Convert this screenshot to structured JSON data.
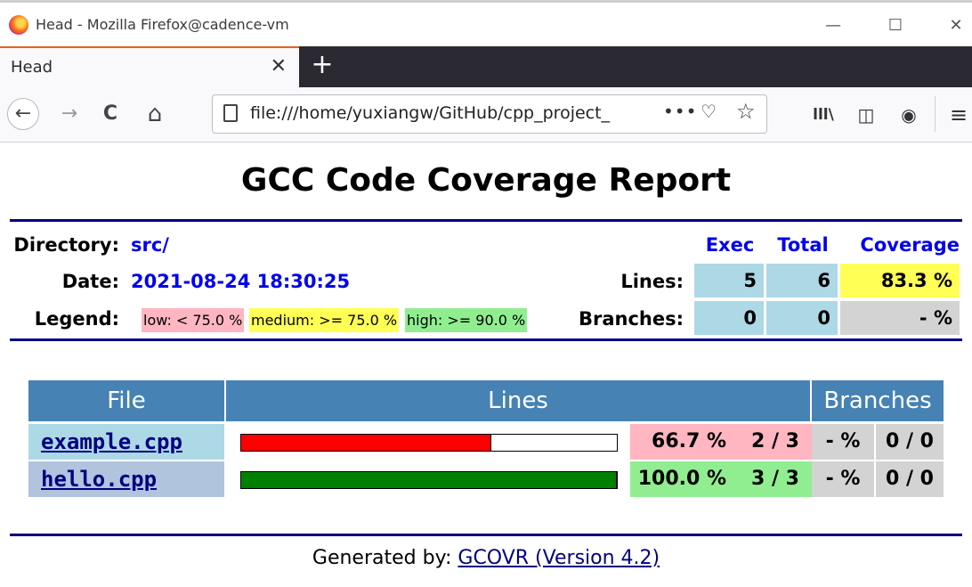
{
  "window": {
    "title": "Head - Mozilla Firefox@cadence-vm",
    "minimize_glyph": "—",
    "maximize_glyph": "☐",
    "close_glyph": "✕"
  },
  "tabs": [
    {
      "label": "Head",
      "close_glyph": "✕"
    }
  ],
  "new_tab_glyph": "+",
  "nav": {
    "back_glyph": "←",
    "forward_glyph": "→",
    "reload_glyph": "C",
    "home_glyph": "⌂",
    "url": "file:///home/yuxiangw/GitHub/cpp_project_",
    "more_glyph": "•••",
    "pocket_glyph": "♡",
    "bookmark_glyph": "☆",
    "library_glyph": "lll\\",
    "sidebar_glyph": "◫",
    "account_glyph": "◉",
    "menu_glyph": "≡"
  },
  "report": {
    "title": "GCC Code Coverage Report",
    "directory_label": "Directory:",
    "directory_value": "src/",
    "date_label": "Date:",
    "date_value": "2021-08-24 18:30:25",
    "legend_label": "Legend:",
    "legend": [
      {
        "text": "low: < 75.0 %",
        "color": "#ffb6c1"
      },
      {
        "text": "medium: >= 75.0 %",
        "color": "#ffff55"
      },
      {
        "text": "high: >= 90.0 %",
        "color": "#90ee90"
      }
    ],
    "summary_headers": {
      "exec": "Exec",
      "total": "Total",
      "coverage": "Coverage"
    },
    "summary_rows": [
      {
        "label": "Lines:",
        "exec": "5",
        "total": "6",
        "coverage": "83.3 %",
        "coverage_color": "#ffff55"
      },
      {
        "label": "Branches:",
        "exec": "0",
        "total": "0",
        "coverage": "- %",
        "coverage_color": "#d3d3d3"
      }
    ],
    "table_headers": {
      "file": "File",
      "lines": "Lines",
      "branches": "Branches"
    },
    "files": [
      {
        "name": "example.cpp",
        "line_fraction": 0.667,
        "bar_color": "#ff0000",
        "line_pct": "66.7 %",
        "line_ratio": "2 / 3",
        "pct_color": "#ffb6c1",
        "branch_pct": "- %",
        "branch_ratio": "0 / 0",
        "row_color": "#add8e6"
      },
      {
        "name": "hello.cpp",
        "line_fraction": 1.0,
        "bar_color": "#008000",
        "line_pct": "100.0 %",
        "line_ratio": "3 / 3",
        "pct_color": "#90ee90",
        "branch_pct": "- %",
        "branch_ratio": "0 / 0",
        "row_color": "#b0c4de"
      }
    ],
    "footer_prefix": "Generated by: ",
    "footer_link": "GCOVR (Version 4.2)"
  },
  "colors": {
    "summary_cell": "#add8e6",
    "header_blue": "#4682b4",
    "rule": "#000080",
    "neutral_cell": "#d3d3d3"
  }
}
